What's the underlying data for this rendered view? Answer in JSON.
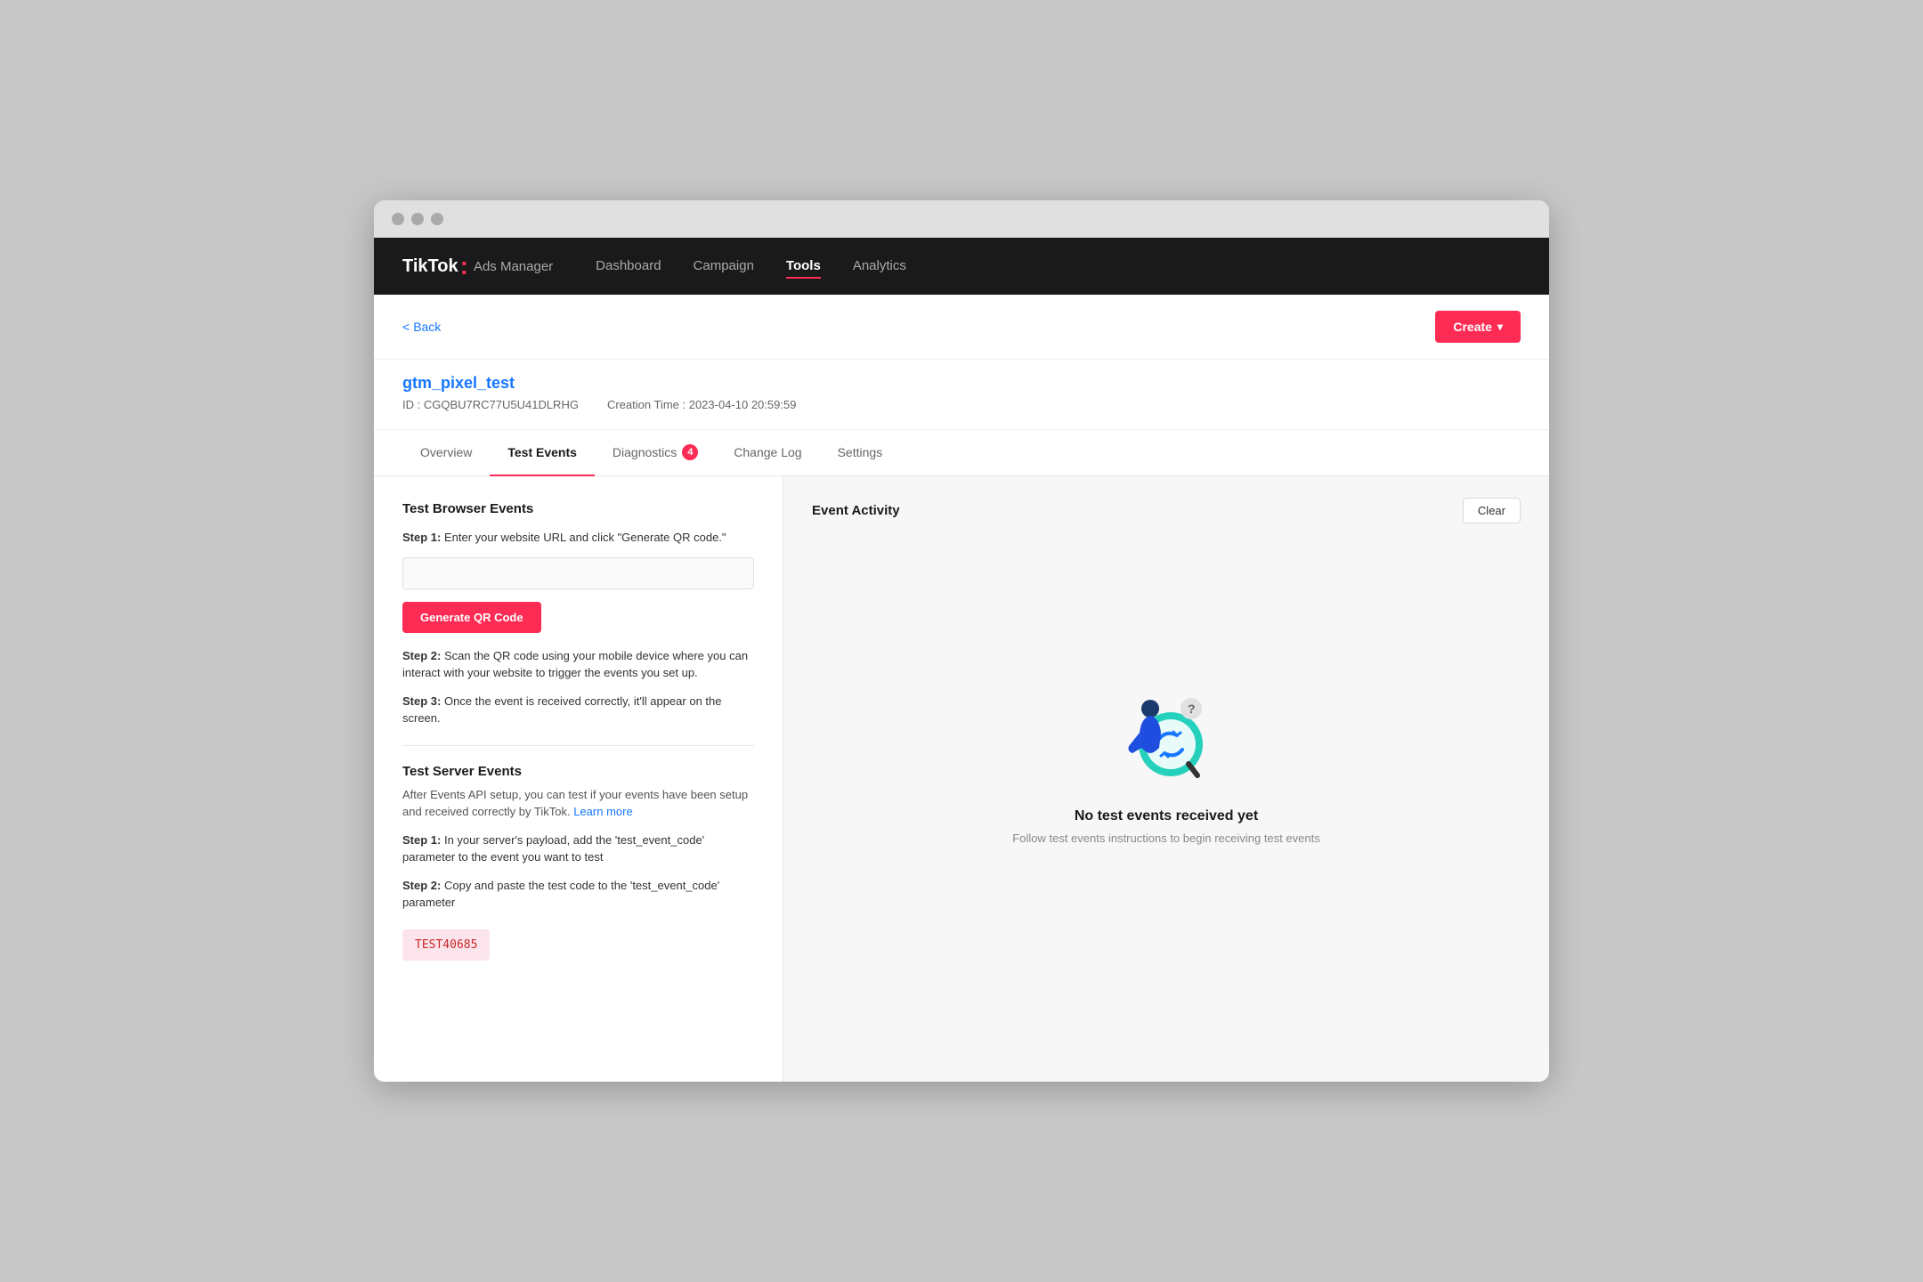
{
  "browser": {
    "traffic_lights": [
      "close",
      "minimize",
      "maximize"
    ]
  },
  "nav": {
    "logo_main": "TikTok",
    "logo_colon": ":",
    "logo_sub": "Ads Manager",
    "items": [
      {
        "label": "Dashboard",
        "active": false
      },
      {
        "label": "Campaign",
        "active": false
      },
      {
        "label": "Tools",
        "active": true
      },
      {
        "label": "Analytics",
        "active": false
      }
    ]
  },
  "toolbar": {
    "back_label": "Back",
    "create_label": "Create"
  },
  "pixel": {
    "name": "gtm_pixel_test",
    "id_label": "ID : CGQBU7RC77U5U41DLRHG",
    "creation_label": "Creation Time : 2023-04-10 20:59:59"
  },
  "tabs": [
    {
      "label": "Overview",
      "active": false,
      "badge": null
    },
    {
      "label": "Test Events",
      "active": true,
      "badge": null
    },
    {
      "label": "Diagnostics",
      "active": false,
      "badge": "4"
    },
    {
      "label": "Change Log",
      "active": false,
      "badge": null
    },
    {
      "label": "Settings",
      "active": false,
      "badge": null
    }
  ],
  "left_panel": {
    "browser_section_title": "Test Browser Events",
    "step1_label": "Step 1:",
    "step1_text": "Enter your website URL and click \"Generate QR code.\"",
    "url_placeholder": "",
    "generate_btn_label": "Generate QR Code",
    "step2_label": "Step 2:",
    "step2_text": "Scan the QR code using your mobile device where you can interact with your website to trigger the events you set up.",
    "step3_label": "Step 3:",
    "step3_text": "Once the event is received correctly, it'll appear on the screen.",
    "server_section_title": "Test Server Events",
    "server_description": "After Events API setup, you can test if your events have been setup and received correctly by TikTok.",
    "learn_more_label": "Learn more",
    "server_step1_label": "Step 1:",
    "server_step1_text": "In your server's payload, add the 'test_event_code' parameter to the event you want to test",
    "server_step2_label": "Step 2:",
    "server_step2_text": "Copy and paste the test code to the 'test_event_code' parameter",
    "test_code": "TEST40685"
  },
  "right_panel": {
    "title": "Event Activity",
    "clear_label": "Clear",
    "empty_title": "No test events received yet",
    "empty_subtitle": "Follow test events instructions to begin receiving test events"
  },
  "colors": {
    "primary": "#fe2c55",
    "link": "#1677ff",
    "nav_bg": "#1a1a1a"
  }
}
